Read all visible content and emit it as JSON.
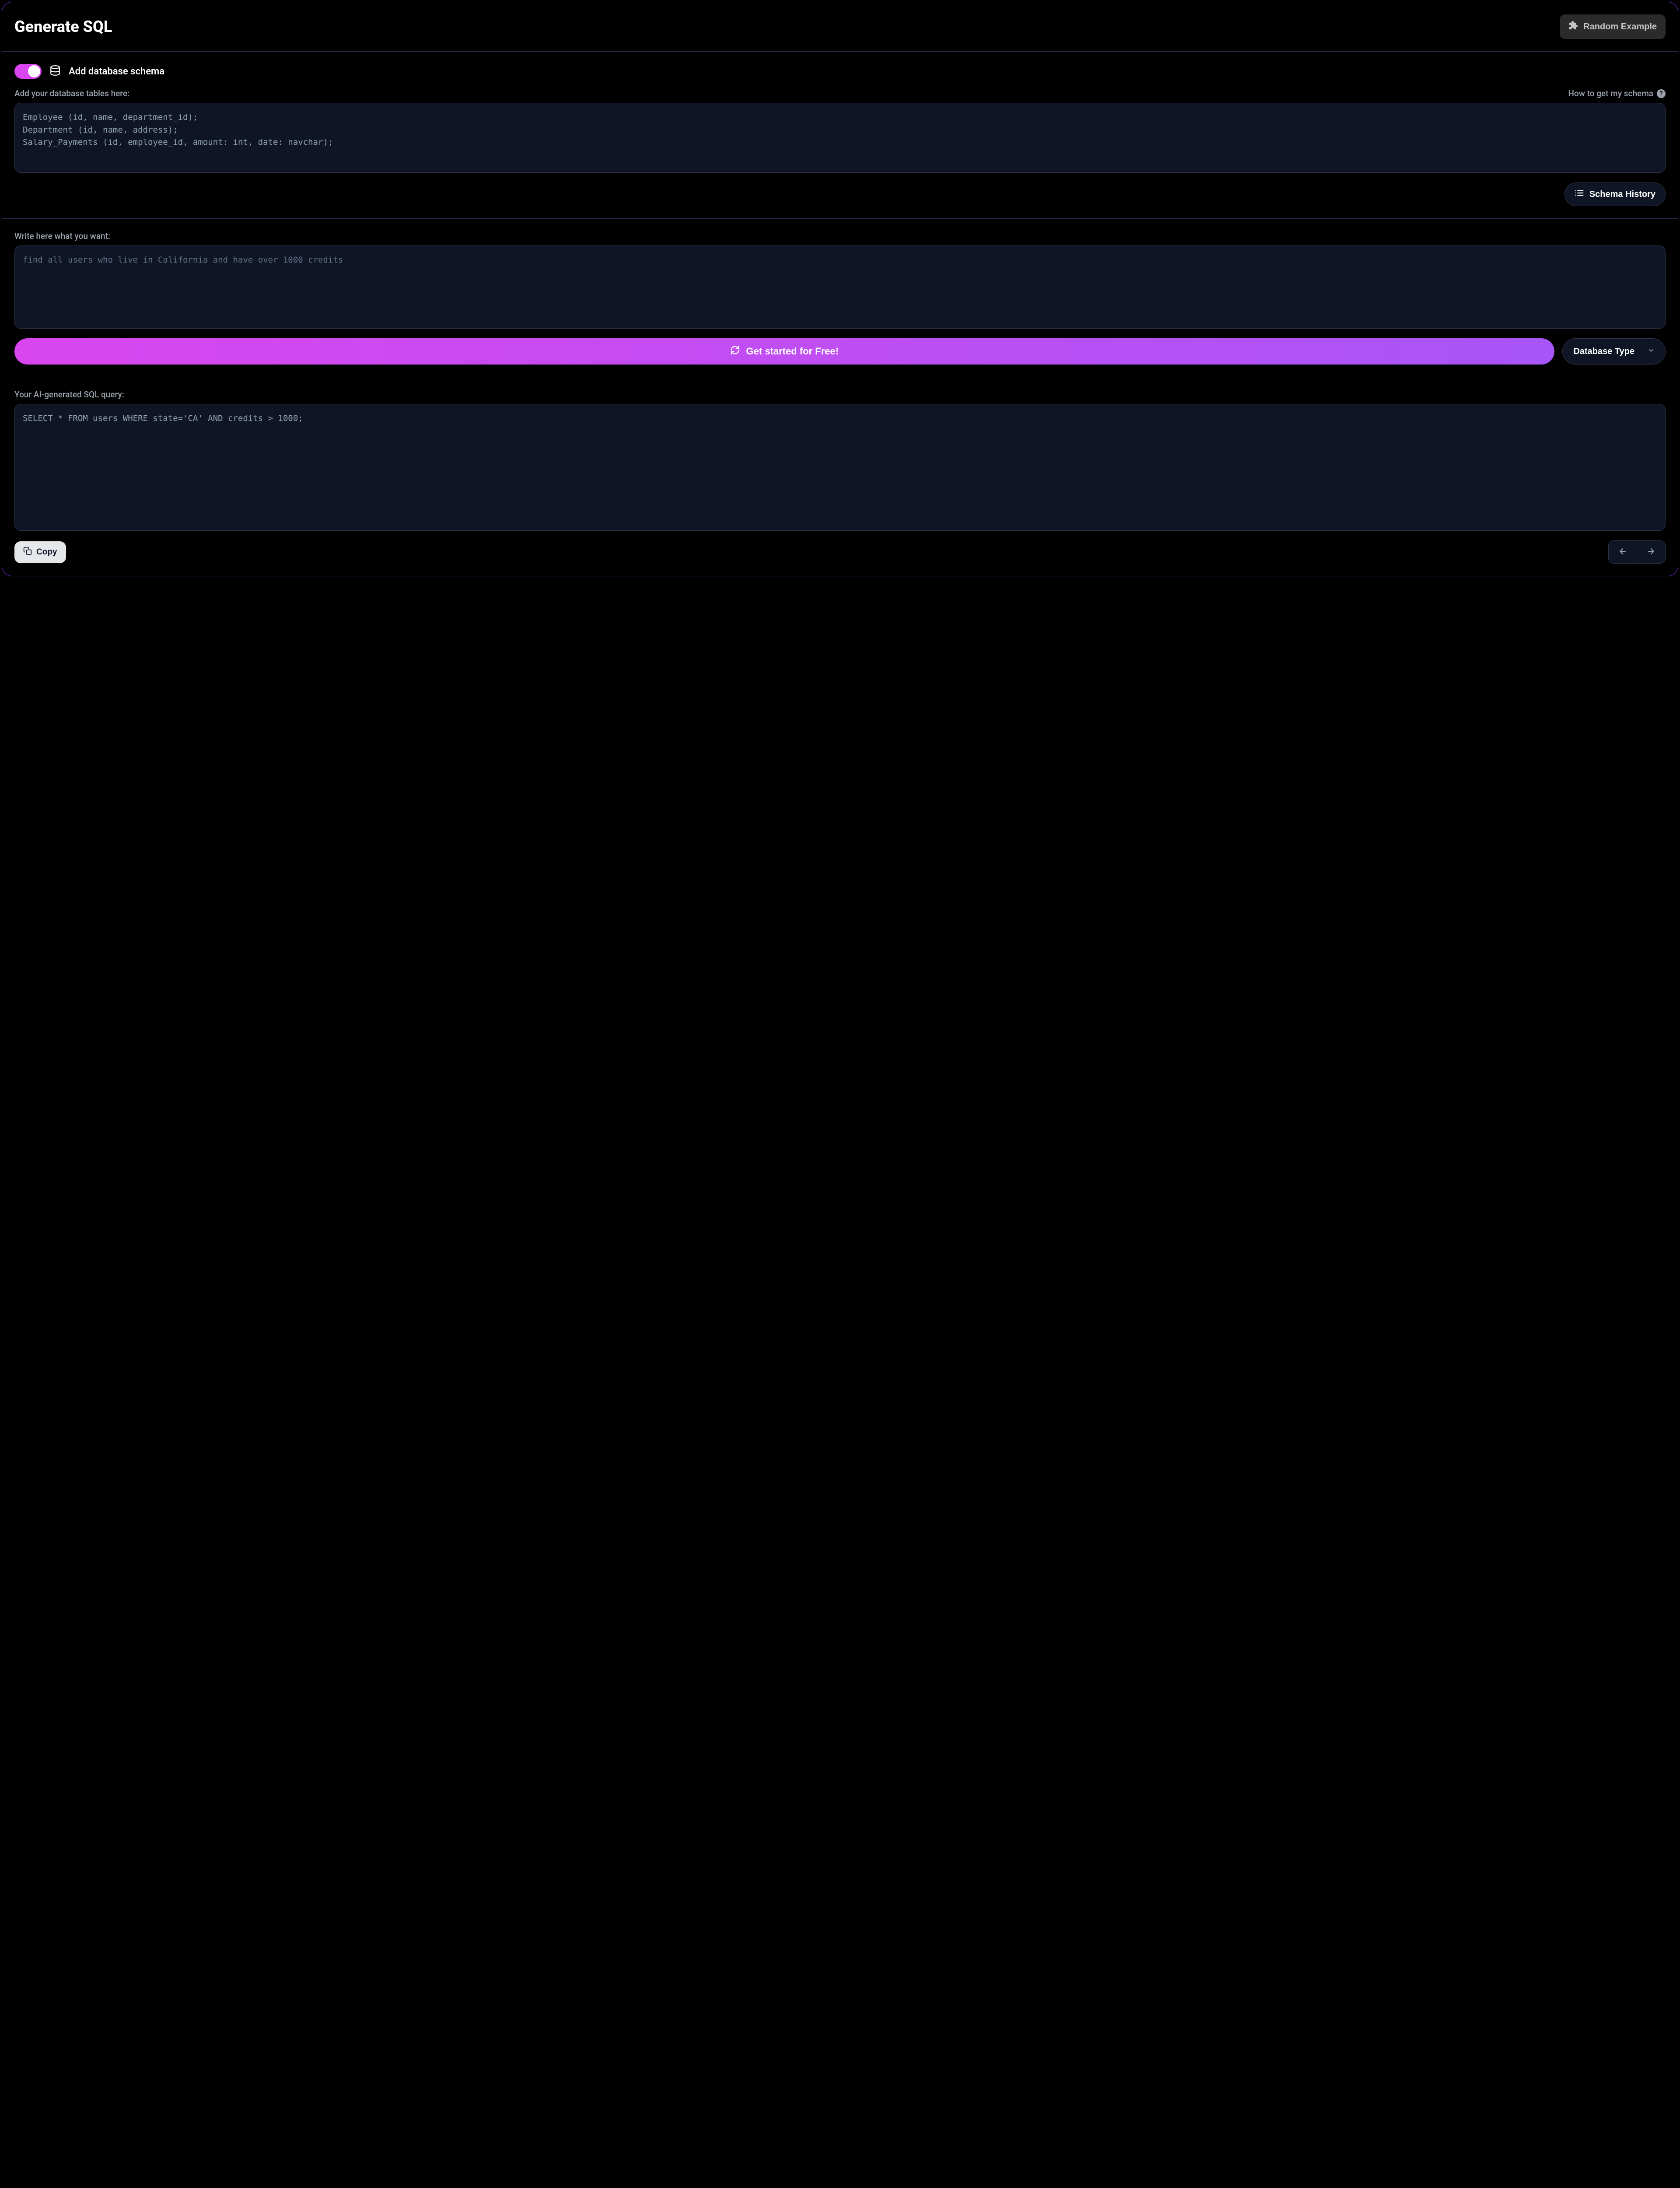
{
  "header": {
    "title": "Generate SQL",
    "random_button": "Random Example"
  },
  "schema": {
    "toggle_label": "Add database schema",
    "input_label": "Add your database tables here:",
    "help_text": "How to get my schema",
    "value": "Employee (id, name, department_id);\nDepartment (id, name, address);\nSalary_Payments (id, employee_id, amount: int, date: navchar);",
    "history_button": "Schema History"
  },
  "prompt": {
    "label": "Write here what you want:",
    "placeholder": "find all users who live in California and have over 1000 credits",
    "cta_button": "Get started for Free!",
    "dbtype_button": "Database Type"
  },
  "result": {
    "label": "Your AI-generated SQL query:",
    "value": "SELECT * FROM users WHERE state='CA' AND credits > 1000;",
    "copy_button": "Copy"
  }
}
